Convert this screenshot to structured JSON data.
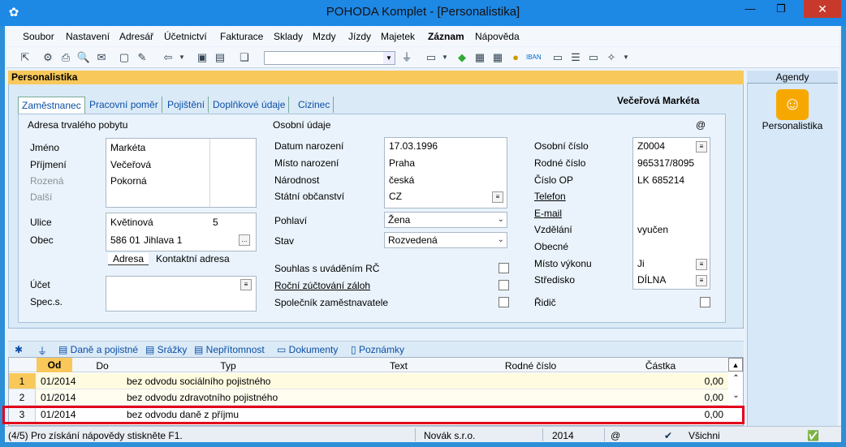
{
  "window": {
    "title": "POHODA Komplet - [Personalistika]"
  },
  "menu": [
    "Soubor",
    "Nastavení",
    "Adresář",
    "Účetnictví",
    "Fakturace",
    "Sklady",
    "Mzdy",
    "Jízdy",
    "Majetek",
    "Záznam",
    "Nápověda"
  ],
  "toolbar": {
    "combo_value": ""
  },
  "agenda": {
    "header": "Agendy",
    "item_label": "Personalistika"
  },
  "section": {
    "title": "Personalistika"
  },
  "tabs": [
    "Zaměstnanec",
    "Pracovní poměr",
    "Pojištění",
    "Doplňkové údaje",
    "Cizinec"
  ],
  "person_name": "Večeřová Markéta",
  "address": {
    "title": "Adresa trvalého pobytu",
    "labels": {
      "jmeno": "Jméno",
      "prijmeni": "Příjmení",
      "rozena": "Rozená",
      "dalsi": "Další",
      "ulice": "Ulice",
      "obec": "Obec",
      "ucet": "Účet",
      "specs": "Spec.s."
    },
    "jmeno": "Markéta",
    "prijmeni": "Večeřová",
    "rozena": "Pokorná",
    "ulice": "Květinová",
    "cislo": "5",
    "psc": "586 01",
    "obec": "Jihlava 1",
    "tab_adresa": "Adresa",
    "tab_kontaktni": "Kontaktní adresa"
  },
  "personal": {
    "title": "Osobní údaje",
    "at_symbol": "@",
    "labels": {
      "datum": "Datum narození",
      "misto": "Místo narození",
      "narodnost": "Národnost",
      "obcanstvi": "Státní občanství",
      "pohlavi": "Pohlaví",
      "stav": "Stav",
      "souhlas": "Souhlas s uváděním RČ",
      "rocni": "Roční zúčtování záloh",
      "spolecnik": "Společník zaměstnavatele"
    },
    "datum": "17.03.1996",
    "misto": "Praha",
    "narodnost": "česká",
    "obcanstvi": "CZ",
    "pohlavi": "Žena",
    "stav": "Rozvedená"
  },
  "ids": {
    "labels": {
      "osobni": "Osobní číslo",
      "rodne": "Rodné číslo",
      "op": "Číslo OP",
      "telefon": "Telefon",
      "email": "E-mail",
      "vzdelani": "Vzdělání",
      "obecne": "Obecné",
      "misto_vykonu": "Místo výkonu",
      "stredisko": "Středisko",
      "ridic": "Řidič"
    },
    "osobni": "Z0004",
    "rodne": "965317/8095",
    "op": "LK 685214",
    "vzdelani": "vyučen",
    "misto_vykonu": "Ji",
    "stredisko": "DÍLNA"
  },
  "subtabs": [
    "Daně a pojistné",
    "Srážky",
    "Nepřítomnost",
    "Dokumenty",
    "Poznámky"
  ],
  "grid": {
    "columns": [
      "Od",
      "Do",
      "Typ",
      "Text",
      "Rodné číslo",
      "Částka"
    ],
    "rows": [
      {
        "n": "1",
        "od": "01/2014",
        "do": "",
        "typ": "bez odvodu sociálního pojistného",
        "text": "",
        "rc": "",
        "castka": "0,00"
      },
      {
        "n": "2",
        "od": "01/2014",
        "do": "",
        "typ": "bez odvodu zdravotního pojistného",
        "text": "",
        "rc": "",
        "castka": "0,00"
      },
      {
        "n": "3",
        "od": "01/2014",
        "do": "",
        "typ": "bez odvodu daně z příjmu",
        "text": "",
        "rc": "",
        "castka": "0,00"
      }
    ]
  },
  "status": {
    "help": "(4/5) Pro získání nápovědy stiskněte F1.",
    "company": "Novák s.r.o.",
    "year": "2014",
    "filter": "Všichni",
    "at": "@"
  }
}
